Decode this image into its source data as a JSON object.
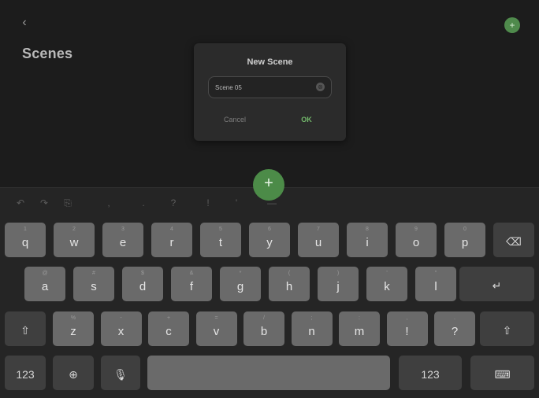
{
  "header": {
    "back_icon": "chevron-left-icon",
    "back_glyph": "‹",
    "title": "Scenes",
    "add_icon": "plus-icon",
    "add_glyph": "+"
  },
  "fab": {
    "glyph": "+"
  },
  "dialog": {
    "title": "New Scene",
    "input_value": "Scene 05",
    "clear_glyph": "⊗",
    "cancel_label": "Cancel",
    "ok_label": "OK"
  },
  "suggestions": [
    "↶",
    "↷",
    "⎘",
    ",",
    ".",
    "?",
    "!",
    "'",
    "—"
  ],
  "keyboard": {
    "row1": [
      {
        "k": "q",
        "a": "1"
      },
      {
        "k": "w",
        "a": "2"
      },
      {
        "k": "e",
        "a": "3"
      },
      {
        "k": "r",
        "a": "4"
      },
      {
        "k": "t",
        "a": "5"
      },
      {
        "k": "y",
        "a": "6"
      },
      {
        "k": "u",
        "a": "7"
      },
      {
        "k": "i",
        "a": "8"
      },
      {
        "k": "o",
        "a": "9"
      },
      {
        "k": "p",
        "a": "0"
      }
    ],
    "row2": [
      {
        "k": "a",
        "a": "@"
      },
      {
        "k": "s",
        "a": "#"
      },
      {
        "k": "d",
        "a": "$"
      },
      {
        "k": "f",
        "a": "&"
      },
      {
        "k": "g",
        "a": "*"
      },
      {
        "k": "h",
        "a": "("
      },
      {
        "k": "j",
        "a": ")"
      },
      {
        "k": "k",
        "a": "'"
      },
      {
        "k": "l",
        "a": "\""
      }
    ],
    "row3": [
      {
        "k": "z",
        "a": "%"
      },
      {
        "k": "x",
        "a": "-"
      },
      {
        "k": "c",
        "a": "+"
      },
      {
        "k": "v",
        "a": "="
      },
      {
        "k": "b",
        "a": "/"
      },
      {
        "k": "n",
        "a": ";"
      },
      {
        "k": "m",
        "a": ":"
      },
      {
        "k": "!",
        "a": ","
      },
      {
        "k": "?",
        "a": "."
      }
    ],
    "backspace": "⌫",
    "return": "↵",
    "shift": "⇧",
    "numbers_label": "123",
    "globe": "⊕",
    "mic": "🎙",
    "hide_keyboard": "⌨"
  }
}
